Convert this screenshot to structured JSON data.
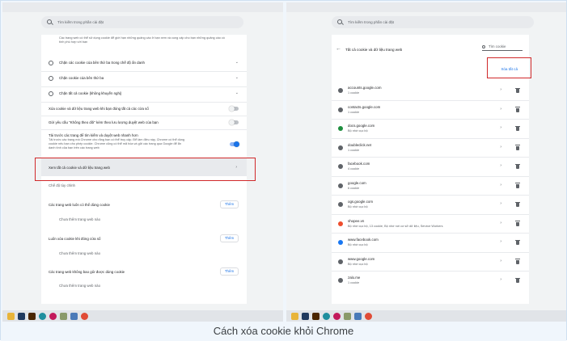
{
  "caption": "Cách xóa cookie khỏi Chrome",
  "left": {
    "search_placeholder": "Tìm kiếm trong phần cài đặt",
    "cutoff_text": "Các trang web có thể sử dụng cookie để giới hạn những quảng cáo ở bạn xem và cung cấp cho bạn những quảng cáo có tính phù hợp với bạn",
    "options": [
      {
        "label": "Chặn các cookie của bên thứ ba trong chế độ ẩn danh"
      },
      {
        "label": "Chặn cookie của bên thứ ba"
      },
      {
        "label": "Chặn tất cả cookie (không khuyến nghị)"
      }
    ],
    "toggle1_label": "Xóa cookie và dữ liệu trang web khi bạn đóng tất cả các cửa sổ",
    "toggle2_label": "Gửi yêu cầu \"Không theo dõi\" kèm theo lưu lượng duyệt web của bạn",
    "preload_title": "Tải trước các trang để tìm kiếm và duyệt web nhanh hơn",
    "preload_desc_1": "Tải trước các trang mà Chrome cho rằng bạn có thể truy cập. Để làm điều này, Chrome có thể dùng",
    "preload_desc_2": "cookie nếu bạn cho phép cookie. Chrome cũng có thể mã hóa và gửi các trang qua Google để ẩn",
    "preload_desc_3": "danh tính của bạn trên các trang web",
    "see_all_label": "Xem tất cả cookie và dữ liệu trang web",
    "custom_behaviors_label": "Chế độ tùy chỉnh",
    "sections": [
      {
        "label": "Các trang web luôn có thể dùng cookie",
        "button": "Thêm",
        "empty": "Chưa thêm trang web nào"
      },
      {
        "label": "Luôn xóa cookie khi đóng cửa sổ",
        "button": "Thêm",
        "empty": "Chưa thêm trang web nào"
      },
      {
        "label": "Các trang web không bao giờ được dùng cookie",
        "button": "Thêm",
        "empty": "Chưa thêm trang web nào"
      }
    ]
  },
  "right": {
    "search_placeholder": "Tìm kiếm trong phần cài đặt",
    "header_title": "Tất cả cookie và dữ liệu trang web",
    "cookie_search_placeholder": "Tìm cookie",
    "remove_all_label": "Xóa tất cả",
    "sites": [
      {
        "name": "accounts.google.com",
        "sub": "1 cookie",
        "icon": "google-icon",
        "color": "#5f6368"
      },
      {
        "name": "contacts.google.com",
        "sub": "1 cookie",
        "icon": "globe-icon",
        "color": "#5f6368"
      },
      {
        "name": "docs.google.com",
        "sub": "Bộ nhớ cục bộ",
        "icon": "docs-icon",
        "color": "#1e8e3e"
      },
      {
        "name": "doubleclick.net",
        "sub": "1 cookie",
        "icon": "globe-icon",
        "color": "#5f6368"
      },
      {
        "name": "facebook.com",
        "sub": "4 cookie",
        "icon": "globe-icon",
        "color": "#5f6368"
      },
      {
        "name": "google.com",
        "sub": "6 cookie",
        "icon": "google-icon",
        "color": "#5f6368"
      },
      {
        "name": "ogs.google.com",
        "sub": "Bộ nhớ cục bộ",
        "icon": "globe-icon",
        "color": "#5f6368"
      },
      {
        "name": "shopee.vn",
        "sub": "Bộ nhớ cục bộ, 13 cookie, Bộ nhớ nơi cơ sở dữ liệu, Service Workers",
        "icon": "shopee-icon",
        "color": "#ee4d2d"
      },
      {
        "name": "www.facebook.com",
        "sub": "Bộ nhớ cục bộ",
        "icon": "facebook-icon",
        "color": "#1877f2"
      },
      {
        "name": "www.google.com",
        "sub": "Bộ nhớ cục bộ",
        "icon": "google-icon",
        "color": "#5f6368"
      },
      {
        "name": "zalo.me",
        "sub": "1 cookie",
        "icon": "globe-icon",
        "color": "#5f6368"
      }
    ]
  },
  "taskbar_icons": [
    {
      "name": "folder-icon",
      "color": "#e8b43a"
    },
    {
      "name": "photoshop-icon",
      "color": "#1f3a5f"
    },
    {
      "name": "illustrator-icon",
      "color": "#4a2500"
    },
    {
      "name": "edge-icon",
      "color": "#1e8e9e"
    },
    {
      "name": "app-icon",
      "color": "#c2185b"
    },
    {
      "name": "pen-icon",
      "color": "#8a9a6a"
    },
    {
      "name": "explorer-icon",
      "color": "#4a7ab8"
    },
    {
      "name": "chrome-icon",
      "color": "#e04b36"
    }
  ]
}
